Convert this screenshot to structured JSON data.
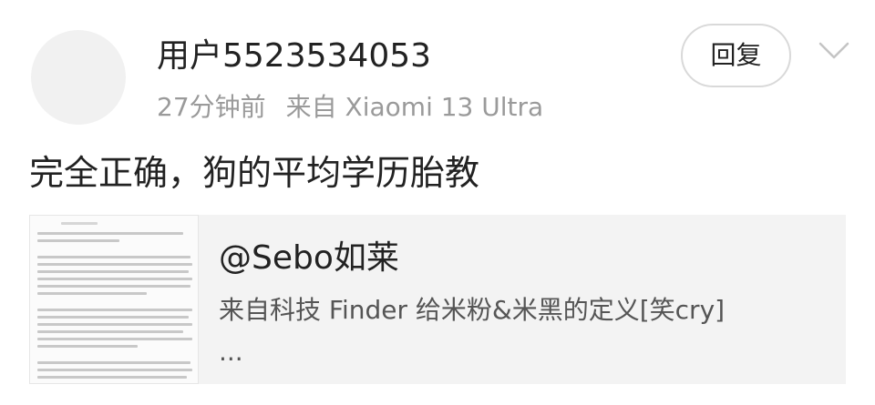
{
  "post": {
    "username": "用户5523534053",
    "time": "27分钟前",
    "source": "来自 Xiaomi 13 Ultra",
    "reply_label": "回复",
    "text": "完全正确，狗的平均学历胎教"
  },
  "quote": {
    "author": "@Sebo如莱",
    "text": "来自科技 Finder 给米粉&米黑的定义[笑cry]",
    "ellipsis": "..."
  },
  "icons": {
    "avatar": "avatar-placeholder",
    "menu": "chevron-down-icon",
    "thumbnail": "article-screenshot-thumbnail"
  },
  "colors": {
    "primary_text": "#222222",
    "secondary_text": "#9a9a9a",
    "quote_background": "#f3f3f3"
  }
}
